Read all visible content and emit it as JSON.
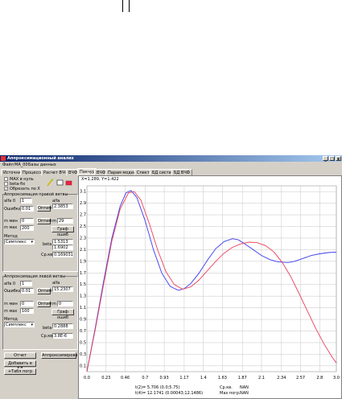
{
  "window": {
    "title": "Аппроксимационный анализ",
    "controls": [
      "_",
      "□",
      "x"
    ]
  },
  "menu": [
    "Файл",
    "MA_00",
    "Базы данных"
  ],
  "tabs": [
    "Источник",
    "Процессы",
    "Расчет ВЧФ",
    "ВЧФ",
    "Пакчур",
    "ВЧФ",
    "Парам модели",
    "Спектр",
    "БД систем",
    "БД ВЧФ"
  ],
  "active_tab_index": 4,
  "options": {
    "items": [
      "MAX в нуль",
      "beta-fix",
      "Обрезать по X"
    ],
    "checked": [
      false,
      false,
      true
    ]
  },
  "group1": {
    "title": "Аппроксимация правой ветвы",
    "alfa0_label": "alfa 0",
    "alfa0_value": "1",
    "alfa_label": "alfa",
    "alfa_value": "2.3853",
    "error_label": "Ошибка",
    "error_value": "0.01",
    "opt_label": "Оптим",
    "tmin_label": "m мин",
    "tmin_value": "0",
    "tmax_label": "m мах",
    "tmax_value": "200",
    "m_label": "m",
    "m_value": "29",
    "graph_label": "Граф ошиб",
    "method_label": "Метод",
    "method_value": "Симплекс",
    "beta_label": "beta",
    "beta_values": [
      "1.5313",
      "1.6902"
    ],
    "skv_label": "Ср.кв.",
    "skv_value": "0.169031"
  },
  "group2": {
    "title": "Аппроксимация левой ветвы",
    "alfa0_label": "alfa 0",
    "alfa0_value": "1",
    "alfa_label": "alfa",
    "alfa_value": "15.2307",
    "error_label": "Ошибка",
    "error_value": "0.01",
    "opt_label": "Оптим",
    "tmin_label": "m мин",
    "tmin_value": "0",
    "tmax_label": "m мах",
    "tmax_value": "100",
    "m_label": "m",
    "m_value": "0",
    "graph_label": "Граф ошиб",
    "method_label": "Метод",
    "method_value": "Симплекс",
    "beta_label": "beta",
    "beta_value": "0.2888",
    "skv_label": "Ср.кв.",
    "skv_value": "3.8E-6"
  },
  "buttons": {
    "report": "Отчет",
    "approx": "Аппроксимировать",
    "add_db": "Добавить в БД",
    "table": "+Табл погр"
  },
  "cursor_readout": "X=1.289, Y=1.422",
  "bottom": {
    "line1": "t(2)=  5.706 (0.0;5.75)",
    "line2": "t(4)=  12.1741 (0.00043;12.1486)",
    "skv_label": "Ср.кв.",
    "skv_value": "NAN",
    "max_label": "Мах погр.",
    "max_value": "NAN"
  },
  "chart_data": {
    "type": "line",
    "x_ticks": [
      "0.0",
      "0.23",
      "0.46",
      "0.7",
      "0.93",
      "1.17",
      "1.4",
      "1.63",
      "1.87",
      "2.1",
      "2.34",
      "2.57",
      "2.8",
      "3.0"
    ],
    "y_ticks": [
      "0.1",
      "0.3",
      "0.5",
      "0.7",
      "0.9",
      "1.1",
      "1.3",
      "1.5",
      "1.7",
      "1.9",
      "2.1",
      "2.3",
      "2.5",
      "2.7",
      "2.9",
      "3.1"
    ],
    "xlim": [
      0,
      3.0
    ],
    "ylim": [
      0,
      3.2
    ],
    "grid": true,
    "series": [
      {
        "color": "#3a3af0",
        "x": [
          0.0,
          0.1,
          0.2,
          0.3,
          0.4,
          0.47,
          0.53,
          0.6,
          0.7,
          0.8,
          0.9,
          1.0,
          1.1,
          1.17,
          1.25,
          1.35,
          1.45,
          1.55,
          1.65,
          1.75,
          1.82,
          1.9,
          2.0,
          2.1,
          2.2,
          2.3,
          2.42,
          2.5,
          2.6,
          2.7,
          2.8,
          2.9,
          3.0
        ],
        "y": [
          0.0,
          0.75,
          1.55,
          2.3,
          2.85,
          3.08,
          3.12,
          3.0,
          2.6,
          2.1,
          1.7,
          1.47,
          1.4,
          1.43,
          1.52,
          1.7,
          1.92,
          2.12,
          2.24,
          2.29,
          2.27,
          2.2,
          2.1,
          2.0,
          1.93,
          1.89,
          1.88,
          1.9,
          1.95,
          2.0,
          2.03,
          2.05,
          2.06
        ]
      },
      {
        "color": "#e8405a",
        "x": [
          0.0,
          0.1,
          0.2,
          0.3,
          0.4,
          0.5,
          0.57,
          0.65,
          0.75,
          0.85,
          0.95,
          1.05,
          1.15,
          1.25,
          1.35,
          1.45,
          1.55,
          1.65,
          1.75,
          1.85,
          1.95,
          2.05,
          2.15,
          2.25,
          2.35,
          2.45,
          2.55,
          2.65,
          2.75,
          2.85,
          2.95,
          3.0
        ],
        "y": [
          0.0,
          0.72,
          1.5,
          2.25,
          2.8,
          3.08,
          3.1,
          2.95,
          2.55,
          2.1,
          1.72,
          1.5,
          1.42,
          1.46,
          1.58,
          1.74,
          1.9,
          2.04,
          2.14,
          2.2,
          2.23,
          2.22,
          2.17,
          2.06,
          1.88,
          1.64,
          1.35,
          1.05,
          0.75,
          0.48,
          0.25,
          0.15
        ]
      }
    ]
  }
}
